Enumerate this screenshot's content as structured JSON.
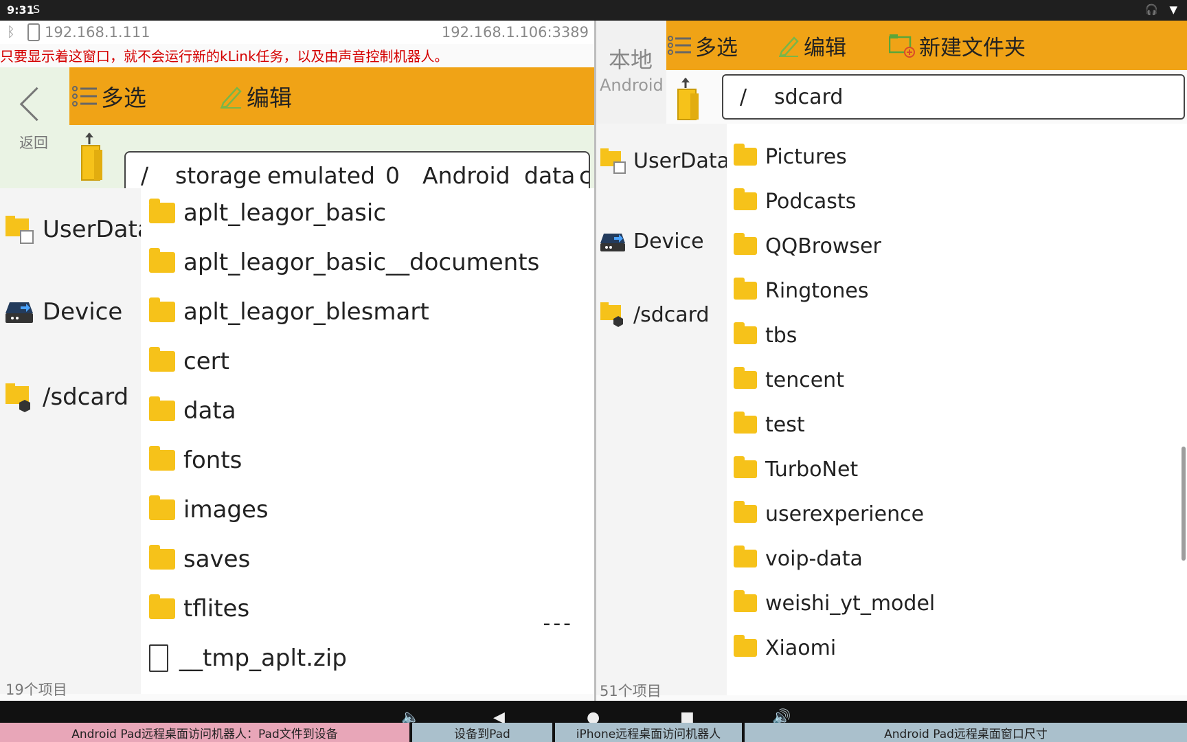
{
  "status_bar": {
    "time": "9:31",
    "sim": "S"
  },
  "connection": {
    "ip_local": "192.168.1.111",
    "ip_remote": "192.168.1.106:3389"
  },
  "warning": "只要显示着这窗口，就不会运行新的kLink任务，以及由声音控制机器人。",
  "left": {
    "back_label": "返回",
    "toolbar": {
      "multi_select": "多选",
      "edit": "编辑"
    },
    "path": [
      "/",
      "storage",
      "emulated",
      "0",
      "Android",
      "data",
      "c"
    ],
    "sidebar": [
      {
        "label": "UserData"
      },
      {
        "label": "Device"
      },
      {
        "label": "/sdcard"
      }
    ],
    "files": [
      {
        "name": "aplt_leagor_basic",
        "type": "folder"
      },
      {
        "name": "aplt_leagor_basic__documents",
        "type": "folder"
      },
      {
        "name": "aplt_leagor_blesmart",
        "type": "folder"
      },
      {
        "name": "cert",
        "type": "folder"
      },
      {
        "name": "data",
        "type": "folder"
      },
      {
        "name": "fonts",
        "type": "folder"
      },
      {
        "name": "images",
        "type": "folder"
      },
      {
        "name": "saves",
        "type": "folder"
      },
      {
        "name": "tflites",
        "type": "folder"
      },
      {
        "name": "__tmp_aplt.zip",
        "type": "file"
      }
    ],
    "file_size_placeholder": "---",
    "item_count": "19个项目"
  },
  "right": {
    "local_label": "本地",
    "android_label": "Android",
    "toolbar": {
      "multi_select": "多选",
      "edit": "编辑",
      "new_folder": "新建文件夹"
    },
    "path": [
      "/",
      "sdcard"
    ],
    "sidebar": [
      {
        "label": "UserData"
      },
      {
        "label": "Device"
      },
      {
        "label": "/sdcard"
      }
    ],
    "files": [
      "Pictures",
      "Podcasts",
      "QQBrowser",
      "Ringtones",
      "tbs",
      "tencent",
      "test",
      "TurboNet",
      "userexperience",
      "voip-data",
      "weishi_yt_model",
      "Xiaomi"
    ],
    "item_count": "51个项目"
  },
  "bottom_tabs": [
    {
      "label": "Android Pad远程桌面访问机器人：Pad文件到设备",
      "color": "#e8a6b8"
    },
    {
      "label": "设备到Pad",
      "color": "#aac0cc"
    },
    {
      "label": "iPhone远程桌面访问机器人",
      "color": "#aac0cc"
    },
    {
      "label": "Android Pad远程桌面窗口尺寸",
      "color": "#aac0cc"
    }
  ],
  "colors": {
    "toolbar": "#f0a316",
    "folder": "#f6c21a",
    "warning": "#d40000"
  }
}
